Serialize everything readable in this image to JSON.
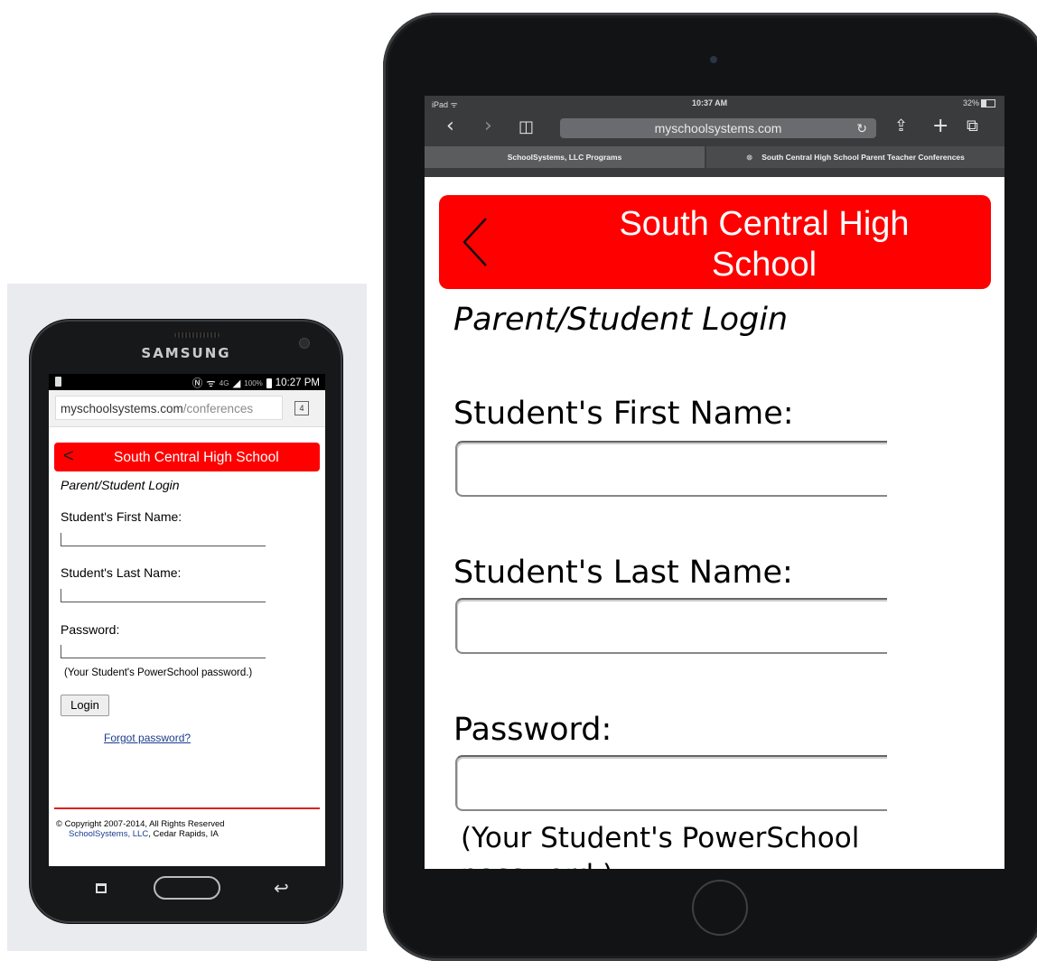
{
  "phone": {
    "brand": "SAMSUNG",
    "status_time": "10:27 PM",
    "status_battery": "100%",
    "status_network": "4G",
    "url_domain": "myschoolsystems.com",
    "url_path": "/conferences",
    "tab_count": "4",
    "header_back": "<",
    "header_title": "South Central High School",
    "subtitle": "Parent/Student Login",
    "first_name_label": "Student's First Name:",
    "last_name_label": "Student's Last Name:",
    "password_label": "Password:",
    "password_hint": "(Your Student's PowerSchool password.)",
    "login_button": "Login",
    "forgot_link": "Forgot password?",
    "copyright": "© Copyright 2007-2014, All Rights Reserved",
    "company_link": "SchoolSystems, LLC",
    "company_location": ", Cedar Rapids, IA"
  },
  "tablet": {
    "status_left": "iPad ᯤ",
    "status_time": "10:37 AM",
    "status_battery": "32%",
    "url": "myschoolsystems.com",
    "tab1": "SchoolSystems, LLC Programs",
    "tab2": "South Central High School Parent Teacher Conferences",
    "tab2_close": "⊗",
    "header_title": "South Central High School",
    "subtitle": "Parent/Student Login",
    "first_name_label": "Student's First Name:",
    "last_name_label": "Student's Last Name:",
    "password_label": "Password:",
    "password_hint": "(Your Student's PowerSchool password.)"
  },
  "icons": {
    "back": "chevron-left-icon",
    "forward": "chevron-right-icon",
    "bookmarks": "book-icon",
    "reload": "reload-icon",
    "share": "share-icon",
    "new_tab": "plus-icon",
    "tabs": "tabs-icon",
    "home": "home-button-icon",
    "recent_apps": "recent-apps-icon",
    "android_back": "android-back-icon"
  },
  "colors": {
    "header_red": "#ff0000",
    "link_blue": "#1a3d8f",
    "footer_rule": "#dd2222"
  }
}
